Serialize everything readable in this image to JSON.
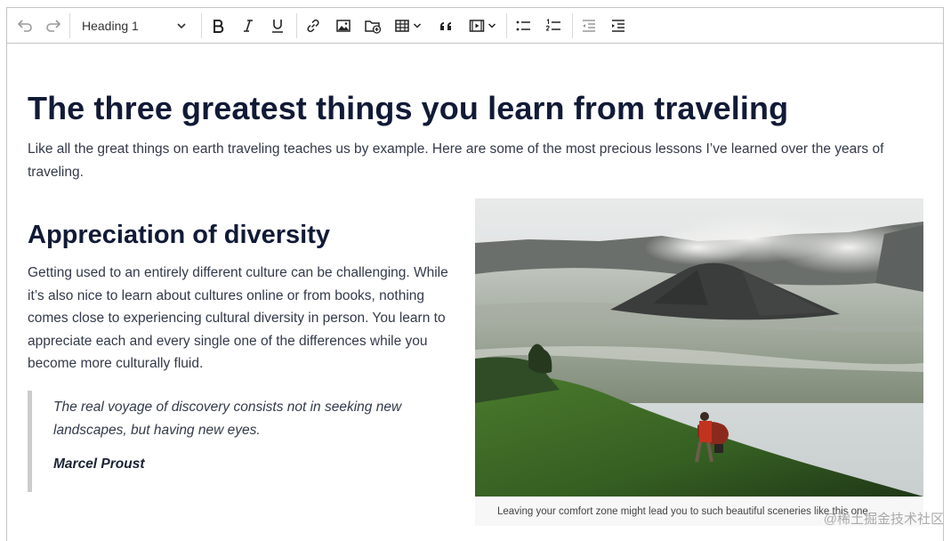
{
  "toolbar": {
    "heading_value": "Heading 1",
    "buttons": [
      "undo",
      "redo",
      "bold",
      "italic",
      "underline",
      "link",
      "image",
      "insert-file",
      "table",
      "blockquote",
      "media",
      "bulleted-list",
      "numbered-list",
      "outdent",
      "indent"
    ]
  },
  "document": {
    "title": "The three greatest things you learn from traveling",
    "intro": "Like all the great things on earth traveling teaches us by example. Here are some of the most precious lessons I’ve learned over the years of traveling.",
    "section_title": "Appreciation of diversity",
    "section_body": "Getting used to an entirely different culture can be challenging. While it’s also nice to learn about cultures online or from books, nothing comes close to experiencing cultural diversity in person. You learn to appreciate each and every single one of the differences while you become more culturally fluid.",
    "quote_text": "The real voyage of discovery consists not in seeking new landscapes, but having new eyes.",
    "quote_author": "Marcel Proust",
    "figure_caption": "Leaving your comfort zone might lead you to such beautiful sceneries like this one."
  },
  "watermark": "@稀土掘金技术社区",
  "colors": {
    "heading": "#111a36",
    "body": "#333a4a",
    "border": "#c4c4c4"
  }
}
